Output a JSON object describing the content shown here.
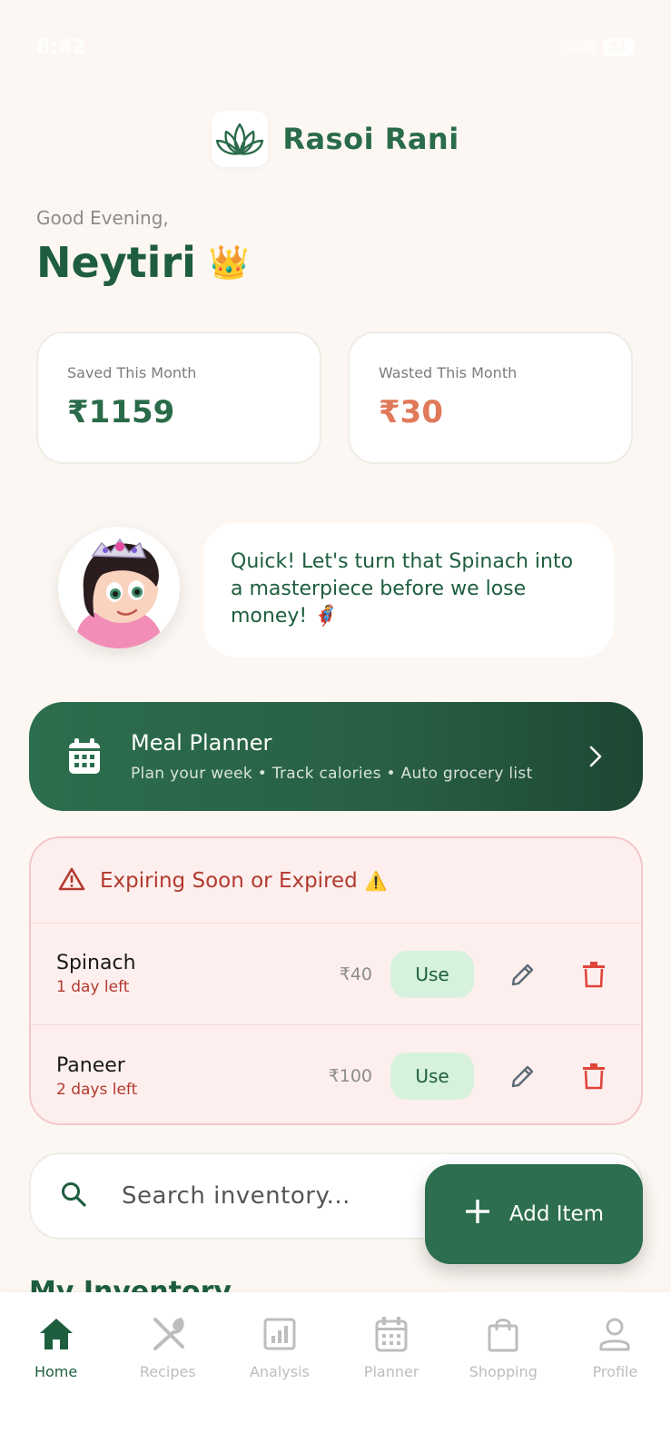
{
  "status_bar": {
    "time": "8:42",
    "battery": "51"
  },
  "header": {
    "app_title": "Rasoi Rani",
    "logo_icon": "lotus-icon"
  },
  "greeting": {
    "salutation": "Good Evening,",
    "name": "Neytiri",
    "emoji": "👑"
  },
  "stats": {
    "saved": {
      "label": "Saved This Month",
      "value": "₹1159"
    },
    "wasted": {
      "label": "Wasted This Month",
      "value": "₹30"
    }
  },
  "mascot": {
    "message": "Quick! Let's turn that Spinach into a masterpiece before we lose money! 🦸"
  },
  "meal_planner": {
    "title": "Meal Planner",
    "subtitle": "Plan your week • Track calories • Auto grocery list"
  },
  "expiring": {
    "title": "Expiring Soon or Expired",
    "warning_emoji": "⚠️",
    "items": [
      {
        "name": "Spinach",
        "days": "1 day left",
        "price": "₹40",
        "use_label": "Use"
      },
      {
        "name": "Paneer",
        "days": "2 days left",
        "price": "₹100",
        "use_label": "Use"
      }
    ]
  },
  "search": {
    "placeholder": "Search inventory..."
  },
  "add_item": {
    "label": "Add Item"
  },
  "inventory": {
    "title": "My Inventory"
  },
  "nav": [
    {
      "label": "Home",
      "icon": "home-icon"
    },
    {
      "label": "Recipes",
      "icon": "utensils-icon"
    },
    {
      "label": "Analysis",
      "icon": "analysis-icon"
    },
    {
      "label": "Planner",
      "icon": "calendar-icon"
    },
    {
      "label": "Shopping",
      "icon": "shopping-bag-icon"
    },
    {
      "label": "Profile",
      "icon": "profile-icon"
    }
  ],
  "colors": {
    "primary": "#2A6B49",
    "background": "#FCF7F2",
    "wasted": "#E07A5A",
    "danger": "#B23A2E",
    "use_bg": "#D6F2DD"
  }
}
